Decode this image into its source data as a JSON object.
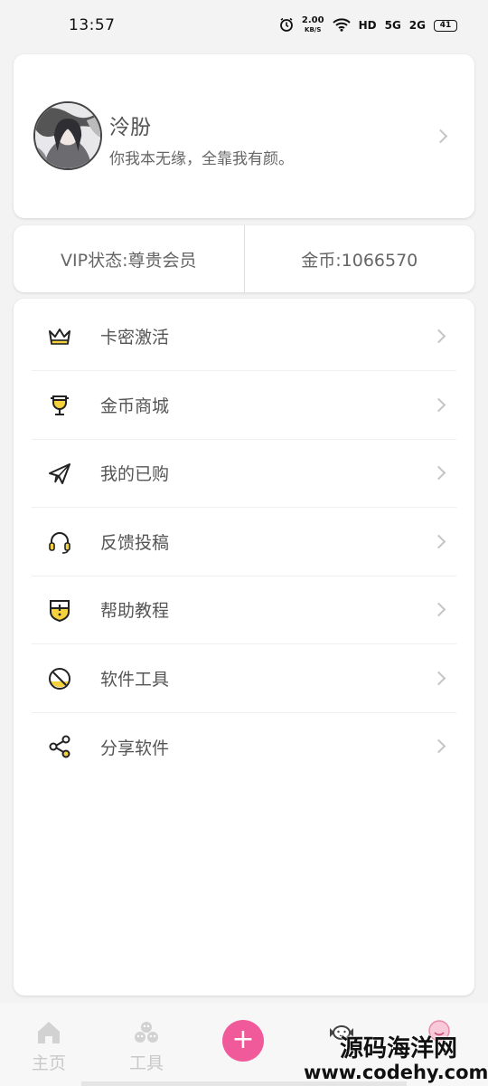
{
  "status_bar": {
    "time": "13:57",
    "speed_value": "2.00",
    "speed_unit": "KB/S",
    "hd": "HD",
    "sig1": "5G",
    "sig2": "2G",
    "battery": "41"
  },
  "profile": {
    "name": "泠朌",
    "signature": "你我本无缘，全靠我有颜。"
  },
  "stats": {
    "vip": "VIP状态:尊贵会员",
    "coins": "金币:1066570"
  },
  "menu": [
    {
      "label": "卡密激活",
      "icon": "crown-icon"
    },
    {
      "label": "金币商城",
      "icon": "trophy-cup-icon"
    },
    {
      "label": "我的已购",
      "icon": "paper-plane-icon"
    },
    {
      "label": "反馈投稿",
      "icon": "headset-icon"
    },
    {
      "label": "帮助教程",
      "icon": "shield-alert-icon"
    },
    {
      "label": "软件工具",
      "icon": "prohibited-circle-icon"
    },
    {
      "label": "分享软件",
      "icon": "share-icon"
    }
  ],
  "bottom_nav": {
    "home": "主页",
    "tools": "工具",
    "add": "+"
  },
  "watermark": {
    "line1": "源码海洋网",
    "line2": "www.codehy.com"
  },
  "colors": {
    "accent_pink": "#f05a9a",
    "icon_yellow": "#f5d23c"
  }
}
